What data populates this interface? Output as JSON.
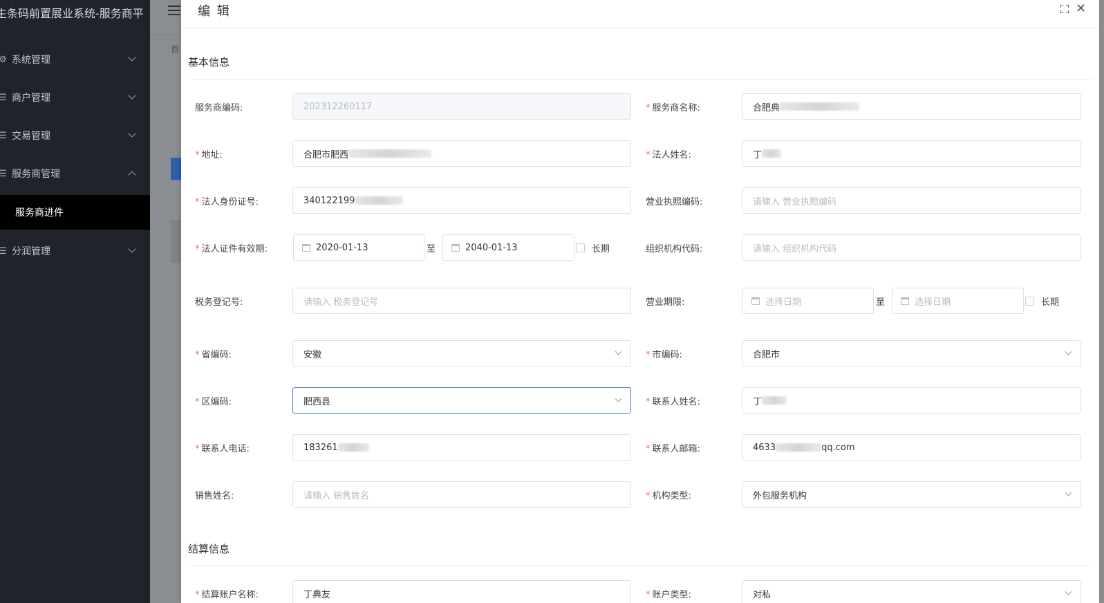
{
  "sidebar": {
    "brand": "生条码前置展业系统-服务商平",
    "menu": [
      {
        "label": "系统管理",
        "icon": "gear-icon"
      },
      {
        "label": "商户管理",
        "icon": "list-icon"
      },
      {
        "label": "交易管理",
        "icon": "list-icon"
      },
      {
        "label": "服务商管理",
        "icon": "list-icon"
      },
      {
        "label": "分润管理",
        "icon": "list-icon"
      }
    ],
    "active_submenu": "服务商进件"
  },
  "background": {
    "tab_label": "首"
  },
  "drawer": {
    "title": "编 辑",
    "sections": {
      "basic": "基本信息",
      "settlement": "结算信息"
    },
    "fields": {
      "provider_code": {
        "label": "服务商编码:",
        "value": "202312260117"
      },
      "provider_name": {
        "label": "服务商名称:",
        "value": "合肥典"
      },
      "address": {
        "label": "地址:",
        "value": "合肥市肥西"
      },
      "legal_name": {
        "label": "法人姓名:",
        "value": "丁"
      },
      "legal_id": {
        "label": "法人身份证号:",
        "value": "340122199"
      },
      "license_no": {
        "label": "营业执照编码:",
        "placeholder": "请输入 营业执照编码"
      },
      "legal_validity": {
        "label": "法人证件有效期:",
        "start": "2020-01-13",
        "to": "至",
        "end": "2040-01-13",
        "long_term": "长期"
      },
      "org_code": {
        "label": "组织机构代码:",
        "placeholder": "请输入 组织机构代码"
      },
      "tax_no": {
        "label": "税务登记号:",
        "placeholder": "请输入 税务登记号"
      },
      "business_term": {
        "label": "营业期限:",
        "start_placeholder": "选择日期",
        "to": "至",
        "end_placeholder": "选择日期",
        "long_term": "长期"
      },
      "province": {
        "label": "省编码:",
        "value": "安徽"
      },
      "city": {
        "label": "市编码:",
        "value": "合肥市"
      },
      "district": {
        "label": "区编码:",
        "value": "肥西县"
      },
      "contact_name": {
        "label": "联系人姓名:",
        "value": "丁"
      },
      "contact_phone": {
        "label": "联系人电话:",
        "value": "183261"
      },
      "contact_email": {
        "label": "联系人邮箱:",
        "value_prefix": "4633",
        "value_suffix": "qq.com"
      },
      "sales_name": {
        "label": "销售姓名:",
        "placeholder": "请输入 销售姓名"
      },
      "org_type": {
        "label": "机构类型:",
        "value": "外包服务机构"
      },
      "settle_account_name": {
        "label": "结算账户名称:",
        "value": "丁典友"
      },
      "account_type": {
        "label": "账户类型:",
        "value": "对私"
      }
    }
  },
  "colors": {
    "sidebar_bg": "#1f232a",
    "required": "#f56c6c",
    "focus_border": "#3d7be0"
  }
}
